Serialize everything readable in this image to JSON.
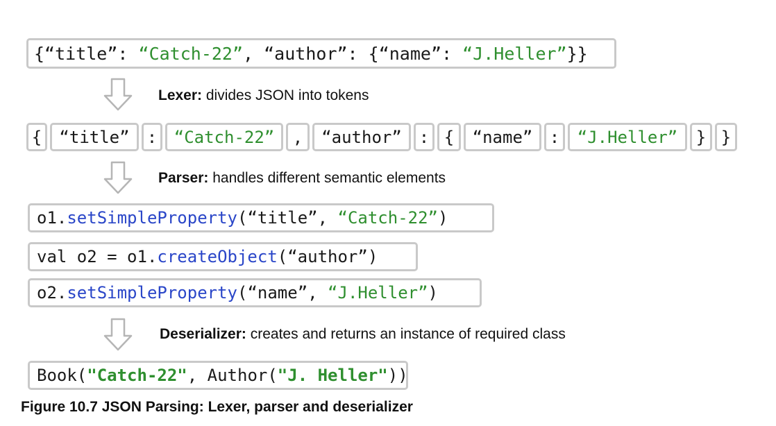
{
  "json_line": {
    "p1": "{“title”: ",
    "s1": "“Catch-22”",
    "p2": ", “author”: {“name”: ",
    "s2": "“J.Heller”",
    "p3": "}}"
  },
  "tokens": [
    "{",
    "“title”",
    ":",
    "“Catch-22”",
    ",",
    "“author”",
    ":",
    "{",
    "“name”",
    ":",
    "“J.Heller”",
    "}",
    "}"
  ],
  "steps": {
    "lexer": {
      "name": "Lexer:",
      "desc": " divides JSON into tokens"
    },
    "parser": {
      "name": "Parser:",
      "desc": " handles different semantic elements"
    },
    "deserializer": {
      "name": "Deserializer:",
      "desc": " creates and returns an instance of required class"
    }
  },
  "parser_code": {
    "line1": {
      "a": "o1.",
      "m": "setSimpleProperty",
      "b": "(“title”, ",
      "s": "“Catch-22”",
      "c": ")"
    },
    "line2": {
      "a": "val o2 = o1.",
      "m": "createObject",
      "b": "(“author”)"
    },
    "line3": {
      "a": "o2.",
      "m": "setSimpleProperty",
      "b": "(“name”, ",
      "s": "“J.Heller”",
      "c": ")"
    }
  },
  "result": {
    "a": "Book(",
    "s1": "\"Catch-22\"",
    "b": ", Author(",
    "s2": "\"J. Heller\"",
    "c": "))"
  },
  "caption": "Figure 10.7 JSON Parsing: Lexer, parser and deserializer",
  "colors": {
    "string": "#2f8f2f",
    "method": "#2a46c8",
    "border": "#c9c9c9"
  }
}
